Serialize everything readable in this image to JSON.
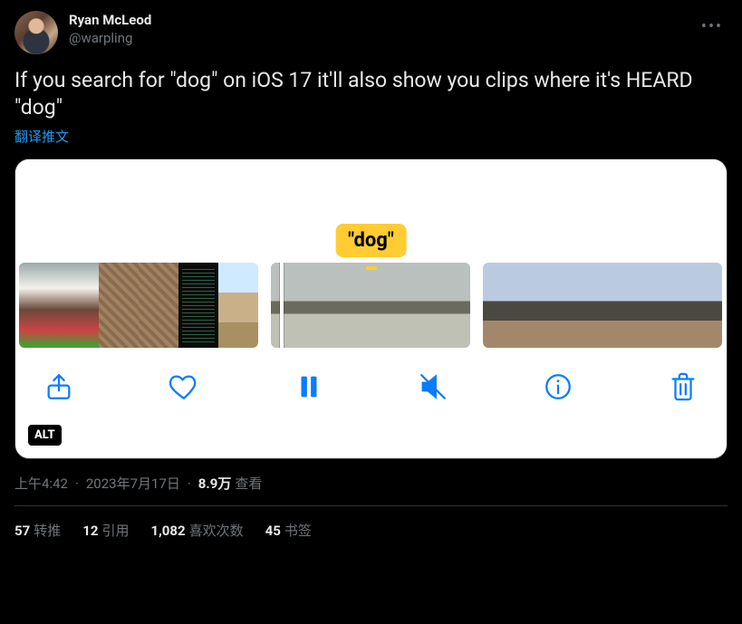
{
  "author": {
    "display_name": "Ryan McLeod",
    "handle": "@warpling"
  },
  "tweet_text": "If you search for \"dog\" on iOS 17 it'll also show you clips where it's HEARD \"dog\"",
  "translate_label": "翻译推文",
  "media": {
    "caption_label": "\"dog\"",
    "alt_badge": "ALT",
    "toolbar_icons": [
      "share-icon",
      "heart-icon",
      "pause-icon",
      "mute-icon",
      "info-icon",
      "trash-icon"
    ]
  },
  "meta": {
    "time": "上午4:42",
    "date": "2023年7月17日",
    "views_count": "8.9万",
    "views_label": "查看"
  },
  "stats": {
    "retweets_count": "57",
    "retweets_label": "转推",
    "quotes_count": "12",
    "quotes_label": "引用",
    "likes_count": "1,082",
    "likes_label": "喜欢次数",
    "bookmarks_count": "45",
    "bookmarks_label": "书签"
  }
}
